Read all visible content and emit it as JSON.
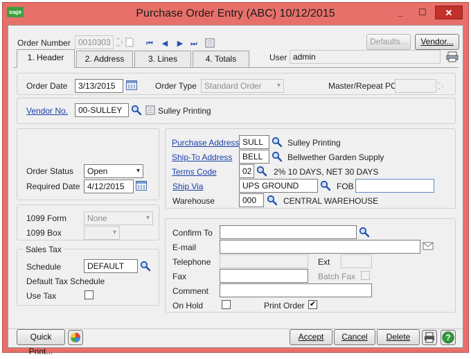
{
  "window": {
    "title": "Purchase Order Entry (ABC) 10/12/2015",
    "logo_text": "sage",
    "min_glyph": "_",
    "max_glyph": "☐",
    "close_glyph": "✕"
  },
  "header": {
    "order_number_label": "Order Number",
    "order_number_value": "0010303",
    "defaults_button": "Defaults...",
    "vendor_button": "Vendor...",
    "user_label": "User",
    "user_value": "admin"
  },
  "tabs": [
    {
      "label": "1. Header"
    },
    {
      "label": "2. Address"
    },
    {
      "label": "3. Lines"
    },
    {
      "label": "4. Totals"
    }
  ],
  "order": {
    "order_date_label": "Order Date",
    "order_date_value": "3/13/2015",
    "order_type_label": "Order Type",
    "order_type_value": "Standard Order",
    "master_repeat_label": "Master/Repeat PO",
    "master_repeat_value": ""
  },
  "vendor": {
    "label": "Vendor No.",
    "value": "00-SULLEY",
    "name": "Sulley Printing"
  },
  "status": {
    "order_status_label": "Order Status",
    "order_status_value": "Open",
    "required_date_label": "Required Date",
    "required_date_value": "4/12/2015"
  },
  "form1099": {
    "form_label": "1099 Form",
    "form_value": "None",
    "box_label": "1099 Box",
    "box_value": ""
  },
  "sales_tax": {
    "group_label": "Sales Tax",
    "schedule_label": "Schedule",
    "schedule_value": "DEFAULT",
    "schedule_desc": "Default Tax Schedule",
    "use_tax_label": "Use Tax",
    "use_tax_checked": false
  },
  "addresses": {
    "purchase_address_label": "Purchase Address",
    "purchase_address_code": "SULL",
    "purchase_address_name": "Sulley Printing",
    "ship_to_label": "Ship-To Address",
    "ship_to_code": "BELL",
    "ship_to_name": "Bellwether Garden Supply",
    "terms_label": "Terms Code",
    "terms_code": "02",
    "terms_desc": "2% 10 DAYS, NET 30 DAYS",
    "ship_via_label": "Ship Via",
    "ship_via_value": "UPS GROUND",
    "fob_label": "FOB",
    "fob_value": "",
    "warehouse_label": "Warehouse",
    "warehouse_code": "000",
    "warehouse_name": "CENTRAL WAREHOUSE"
  },
  "contact": {
    "confirm_to_label": "Confirm To",
    "confirm_to_value": "",
    "email_label": "E-mail",
    "email_value": "",
    "telephone_label": "Telephone",
    "telephone_value": "",
    "ext_label": "Ext",
    "ext_value": "",
    "fax_label": "Fax",
    "fax_value": "",
    "batch_fax_label": "Batch Fax",
    "comment_label": "Comment",
    "comment_value": "",
    "on_hold_label": "On Hold",
    "on_hold_checked": false,
    "print_order_label": "Print Order",
    "print_order_checked": true,
    "check_glyph": "✔"
  },
  "footer": {
    "quick_print": "Quick Print...",
    "accept": "Accept",
    "cancel": "Cancel",
    "delete": "Delete"
  },
  "colors": {
    "title_bar": "#e8706a",
    "link": "#1a3fa8",
    "close_button": "#c4312a"
  }
}
